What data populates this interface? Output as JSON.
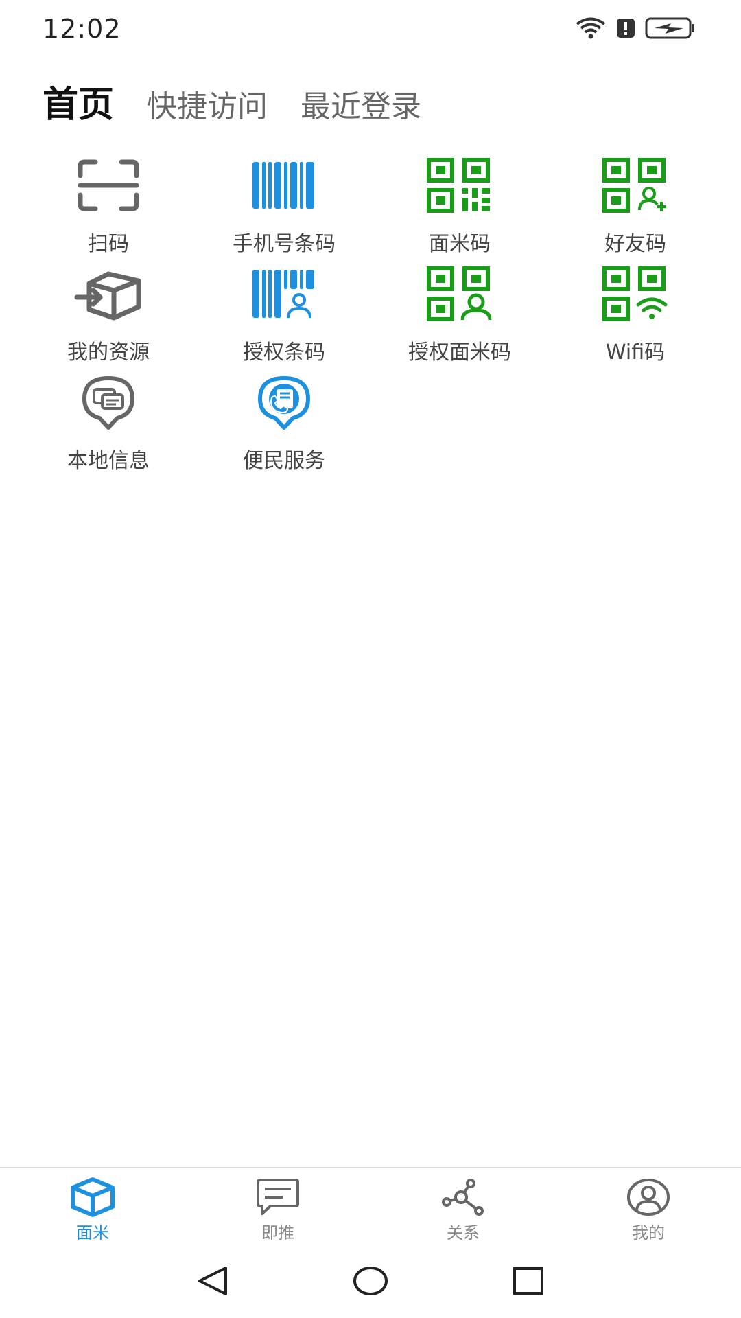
{
  "status_bar": {
    "time": "12:02",
    "icons": [
      "wifi-icon",
      "alert-icon",
      "battery-charging-icon"
    ]
  },
  "top_tabs": [
    {
      "label": "首页",
      "active": true
    },
    {
      "label": "快捷访问",
      "active": false
    },
    {
      "label": "最近登录",
      "active": false
    }
  ],
  "grid": {
    "items": [
      {
        "label": "扫码",
        "icon": "scan-icon"
      },
      {
        "label": "手机号条码",
        "icon": "barcode-icon"
      },
      {
        "label": "面米码",
        "icon": "qr-code-icon"
      },
      {
        "label": "好友码",
        "icon": "qr-add-friend-icon"
      },
      {
        "label": "我的资源",
        "icon": "resource-box-icon"
      },
      {
        "label": "授权条码",
        "icon": "barcode-user-icon"
      },
      {
        "label": "授权面米码",
        "icon": "qr-user-icon"
      },
      {
        "label": "Wifi码",
        "icon": "qr-wifi-icon"
      },
      {
        "label": "本地信息",
        "icon": "local-info-pin-icon"
      },
      {
        "label": "便民服务",
        "icon": "service-pin-icon"
      }
    ]
  },
  "bottom_nav": [
    {
      "label": "面米",
      "icon": "cube-icon",
      "active": true
    },
    {
      "label": "即推",
      "icon": "message-icon",
      "active": false
    },
    {
      "label": "关系",
      "icon": "network-icon",
      "active": false
    },
    {
      "label": "我的",
      "icon": "profile-icon",
      "active": false
    }
  ],
  "colors": {
    "accent_blue": "#1e90e0",
    "qr_green": "#1a9e1a",
    "icon_gray": "#666666"
  }
}
